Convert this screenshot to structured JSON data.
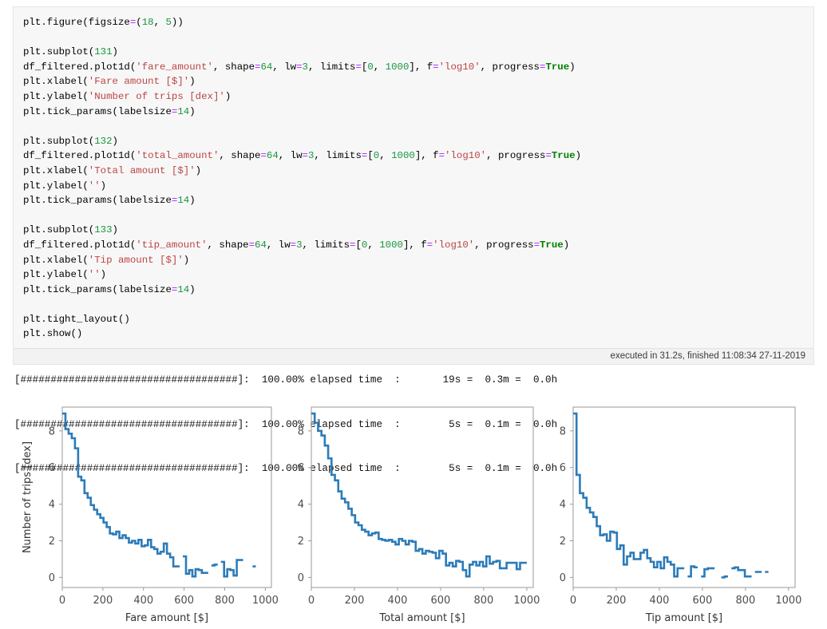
{
  "notebook": {
    "cell": {
      "language": "python",
      "code_lines": [
        [
          {
            "t": "plt.figure(figsize",
            "c": "fn"
          },
          {
            "t": "=",
            "c": "op"
          },
          {
            "t": "(",
            "c": "fn"
          },
          {
            "t": "18",
            "c": "num"
          },
          {
            "t": ", ",
            "c": "fn"
          },
          {
            "t": "5",
            "c": "num"
          },
          {
            "t": "))",
            "c": "fn"
          }
        ],
        [],
        [
          {
            "t": "plt.subplot(",
            "c": "fn"
          },
          {
            "t": "131",
            "c": "num"
          },
          {
            "t": ")",
            "c": "fn"
          }
        ],
        [
          {
            "t": "df_filtered.plot1d(",
            "c": "fn"
          },
          {
            "t": "'fare_amount'",
            "c": "str"
          },
          {
            "t": ", shape",
            "c": "fn"
          },
          {
            "t": "=",
            "c": "op"
          },
          {
            "t": "64",
            "c": "num"
          },
          {
            "t": ", lw",
            "c": "fn"
          },
          {
            "t": "=",
            "c": "op"
          },
          {
            "t": "3",
            "c": "num"
          },
          {
            "t": ", limits",
            "c": "fn"
          },
          {
            "t": "=",
            "c": "op"
          },
          {
            "t": "[",
            "c": "fn"
          },
          {
            "t": "0",
            "c": "num"
          },
          {
            "t": ", ",
            "c": "fn"
          },
          {
            "t": "1000",
            "c": "num"
          },
          {
            "t": "], f",
            "c": "fn"
          },
          {
            "t": "=",
            "c": "op"
          },
          {
            "t": "'log10'",
            "c": "str"
          },
          {
            "t": ", progress",
            "c": "fn"
          },
          {
            "t": "=",
            "c": "op"
          },
          {
            "t": "True",
            "c": "bool"
          },
          {
            "t": ")",
            "c": "fn"
          }
        ],
        [
          {
            "t": "plt.xlabel(",
            "c": "fn"
          },
          {
            "t": "'Fare amount [$]'",
            "c": "str"
          },
          {
            "t": ")",
            "c": "fn"
          }
        ],
        [
          {
            "t": "plt.ylabel(",
            "c": "fn"
          },
          {
            "t": "'Number of trips [dex]'",
            "c": "str"
          },
          {
            "t": ")",
            "c": "fn"
          }
        ],
        [
          {
            "t": "plt.tick_params(labelsize",
            "c": "fn"
          },
          {
            "t": "=",
            "c": "op"
          },
          {
            "t": "14",
            "c": "num"
          },
          {
            "t": ")",
            "c": "fn"
          }
        ],
        [],
        [
          {
            "t": "plt.subplot(",
            "c": "fn"
          },
          {
            "t": "132",
            "c": "num"
          },
          {
            "t": ")",
            "c": "fn"
          }
        ],
        [
          {
            "t": "df_filtered.plot1d(",
            "c": "fn"
          },
          {
            "t": "'total_amount'",
            "c": "str"
          },
          {
            "t": ", shape",
            "c": "fn"
          },
          {
            "t": "=",
            "c": "op"
          },
          {
            "t": "64",
            "c": "num"
          },
          {
            "t": ", lw",
            "c": "fn"
          },
          {
            "t": "=",
            "c": "op"
          },
          {
            "t": "3",
            "c": "num"
          },
          {
            "t": ", limits",
            "c": "fn"
          },
          {
            "t": "=",
            "c": "op"
          },
          {
            "t": "[",
            "c": "fn"
          },
          {
            "t": "0",
            "c": "num"
          },
          {
            "t": ", ",
            "c": "fn"
          },
          {
            "t": "1000",
            "c": "num"
          },
          {
            "t": "], f",
            "c": "fn"
          },
          {
            "t": "=",
            "c": "op"
          },
          {
            "t": "'log10'",
            "c": "str"
          },
          {
            "t": ", progress",
            "c": "fn"
          },
          {
            "t": "=",
            "c": "op"
          },
          {
            "t": "True",
            "c": "bool"
          },
          {
            "t": ")",
            "c": "fn"
          }
        ],
        [
          {
            "t": "plt.xlabel(",
            "c": "fn"
          },
          {
            "t": "'Total amount [$]'",
            "c": "str"
          },
          {
            "t": ")",
            "c": "fn"
          }
        ],
        [
          {
            "t": "plt.ylabel(",
            "c": "fn"
          },
          {
            "t": "''",
            "c": "str"
          },
          {
            "t": ")",
            "c": "fn"
          }
        ],
        [
          {
            "t": "plt.tick_params(labelsize",
            "c": "fn"
          },
          {
            "t": "=",
            "c": "op"
          },
          {
            "t": "14",
            "c": "num"
          },
          {
            "t": ")",
            "c": "fn"
          }
        ],
        [],
        [
          {
            "t": "plt.subplot(",
            "c": "fn"
          },
          {
            "t": "133",
            "c": "num"
          },
          {
            "t": ")",
            "c": "fn"
          }
        ],
        [
          {
            "t": "df_filtered.plot1d(",
            "c": "fn"
          },
          {
            "t": "'tip_amount'",
            "c": "str"
          },
          {
            "t": ", shape",
            "c": "fn"
          },
          {
            "t": "=",
            "c": "op"
          },
          {
            "t": "64",
            "c": "num"
          },
          {
            "t": ", lw",
            "c": "fn"
          },
          {
            "t": "=",
            "c": "op"
          },
          {
            "t": "3",
            "c": "num"
          },
          {
            "t": ", limits",
            "c": "fn"
          },
          {
            "t": "=",
            "c": "op"
          },
          {
            "t": "[",
            "c": "fn"
          },
          {
            "t": "0",
            "c": "num"
          },
          {
            "t": ", ",
            "c": "fn"
          },
          {
            "t": "1000",
            "c": "num"
          },
          {
            "t": "], f",
            "c": "fn"
          },
          {
            "t": "=",
            "c": "op"
          },
          {
            "t": "'log10'",
            "c": "str"
          },
          {
            "t": ", progress",
            "c": "fn"
          },
          {
            "t": "=",
            "c": "op"
          },
          {
            "t": "True",
            "c": "bool"
          },
          {
            "t": ")",
            "c": "fn"
          }
        ],
        [
          {
            "t": "plt.xlabel(",
            "c": "fn"
          },
          {
            "t": "'Tip amount [$]'",
            "c": "str"
          },
          {
            "t": ")",
            "c": "fn"
          }
        ],
        [
          {
            "t": "plt.ylabel(",
            "c": "fn"
          },
          {
            "t": "''",
            "c": "str"
          },
          {
            "t": ")",
            "c": "fn"
          }
        ],
        [
          {
            "t": "plt.tick_params(labelsize",
            "c": "fn"
          },
          {
            "t": "=",
            "c": "op"
          },
          {
            "t": "14",
            "c": "num"
          },
          {
            "t": ")",
            "c": "fn"
          }
        ],
        [],
        [
          {
            "t": "plt.tight_layout()",
            "c": "fn"
          }
        ],
        [
          {
            "t": "plt.show()",
            "c": "fn"
          }
        ]
      ],
      "execution_info": "executed in 31.2s, finished 11:08:34 27-11-2019"
    },
    "output": {
      "progress_lines": [
        "[####################################]:  100.00% elapsed time  :       19s =  0.3m =  0.0h",
        "[####################################]:  100.00% elapsed time  :        5s =  0.1m =  0.0h",
        "[####################################]:  100.00% elapsed time  :        5s =  0.1m =  0.0h"
      ]
    }
  },
  "theme": {
    "line_color": "#2b7bb9",
    "axis_color": "#9a9a9a",
    "tick_text_color": "#4d4d4d",
    "cell_background": "#f7f7f7",
    "exec_bar_background": "#f2f2f2"
  },
  "chart_data": [
    {
      "type": "line",
      "title": "",
      "xlabel": "Fare amount [$]",
      "ylabel": "Number of trips [dex]",
      "xlim": [
        0,
        1030
      ],
      "ylim": [
        -0.55,
        9.3
      ],
      "xticks": [
        0,
        200,
        400,
        600,
        800,
        1000
      ],
      "yticks": [
        0,
        2,
        4,
        6,
        8
      ],
      "grid": false,
      "legend": "none",
      "bin_edges_step": 15.625,
      "x": [
        0,
        15.6,
        31.3,
        46.9,
        62.5,
        78.1,
        93.8,
        109.4,
        125,
        140.6,
        156.3,
        171.9,
        187.5,
        203.1,
        218.8,
        234.4,
        250,
        265.6,
        281.3,
        296.9,
        312.5,
        328.1,
        343.8,
        359.4,
        375,
        390.6,
        406.3,
        421.9,
        437.5,
        453.1,
        468.8,
        484.4,
        500,
        515.6,
        531.3,
        546.9,
        562.5,
        578.1,
        593.8,
        609.4,
        625,
        640.6,
        656.3,
        671.9,
        687.5,
        703.1,
        718.8,
        734.4,
        750,
        765.6,
        781.3,
        796.9,
        812.5,
        828.1,
        843.8,
        859.4,
        875,
        890.6,
        906.3,
        921.9,
        937.5,
        953.1,
        968.8,
        984.4
      ],
      "values": [
        8.95,
        8.1,
        7.85,
        7.6,
        7.05,
        5.5,
        5.3,
        4.6,
        4.35,
        3.95,
        3.7,
        3.45,
        3.25,
        3.0,
        2.75,
        2.4,
        2.35,
        2.5,
        2.15,
        2.3,
        2.15,
        1.9,
        2.0,
        1.85,
        2.05,
        1.7,
        1.75,
        2.05,
        1.65,
        1.55,
        1.3,
        1.4,
        1.85,
        1.3,
        1.1,
        0.6,
        0.6,
        null,
        1.15,
        0.2,
        0.4,
        0.05,
        0.45,
        0.4,
        0.25,
        0.25,
        null,
        0.65,
        0.7,
        null,
        0.85,
        0.05,
        0.45,
        0.4,
        0.1,
        0.95,
        0.95,
        null,
        null,
        null,
        0.6,
        null,
        null,
        null
      ]
    },
    {
      "type": "line",
      "title": "",
      "xlabel": "Total amount [$]",
      "ylabel": "",
      "xlim": [
        0,
        1030
      ],
      "ylim": [
        -0.55,
        9.3
      ],
      "xticks": [
        0,
        200,
        400,
        600,
        800,
        1000
      ],
      "yticks": [
        0,
        2,
        4,
        6,
        8
      ],
      "grid": false,
      "legend": "none",
      "bin_edges_step": 15.625,
      "x": [
        0,
        15.6,
        31.3,
        46.9,
        62.5,
        78.1,
        93.8,
        109.4,
        125,
        140.6,
        156.3,
        171.9,
        187.5,
        203.1,
        218.8,
        234.4,
        250,
        265.6,
        281.3,
        296.9,
        312.5,
        328.1,
        343.8,
        359.4,
        375,
        390.6,
        406.3,
        421.9,
        437.5,
        453.1,
        468.8,
        484.4,
        500,
        515.6,
        531.3,
        546.9,
        562.5,
        578.1,
        593.8,
        609.4,
        625,
        640.6,
        656.3,
        671.9,
        687.5,
        703.1,
        718.8,
        734.4,
        750,
        765.6,
        781.3,
        796.9,
        812.5,
        828.1,
        843.8,
        859.4,
        875,
        890.6,
        906.3,
        921.9,
        937.5,
        953.1,
        968.8,
        984.4
      ],
      "values": [
        8.95,
        8.45,
        8.0,
        7.75,
        7.2,
        6.5,
        5.6,
        5.3,
        4.7,
        4.3,
        4.1,
        3.75,
        3.4,
        3.0,
        2.85,
        2.6,
        2.5,
        2.3,
        2.4,
        2.45,
        2.1,
        2.05,
        2.0,
        2.05,
        1.95,
        1.8,
        2.1,
        2.0,
        1.8,
        2.0,
        1.95,
        1.45,
        1.55,
        1.3,
        1.45,
        1.4,
        1.35,
        1.05,
        1.45,
        1.3,
        0.65,
        0.8,
        0.6,
        0.9,
        0.85,
        0.4,
        0.05,
        0.7,
        0.85,
        0.65,
        0.85,
        0.6,
        1.15,
        0.75,
        0.85,
        0.9,
        0.5,
        0.5,
        0.8,
        0.8,
        0.8,
        0.45,
        0.8,
        0.8
      ]
    },
    {
      "type": "line",
      "title": "",
      "xlabel": "Tip amount [$]",
      "ylabel": "",
      "xlim": [
        0,
        1030
      ],
      "ylim": [
        -0.55,
        9.3
      ],
      "xticks": [
        0,
        200,
        400,
        600,
        800,
        1000
      ],
      "yticks": [
        0,
        2,
        4,
        6,
        8
      ],
      "grid": false,
      "legend": "none",
      "bin_edges_step": 15.625,
      "x": [
        0,
        15.6,
        31.3,
        46.9,
        62.5,
        78.1,
        93.8,
        109.4,
        125,
        140.6,
        156.3,
        171.9,
        187.5,
        203.1,
        218.8,
        234.4,
        250,
        265.6,
        281.3,
        296.9,
        312.5,
        328.1,
        343.8,
        359.4,
        375,
        390.6,
        406.3,
        421.9,
        437.5,
        453.1,
        468.8,
        484.4,
        500,
        515.6,
        531.3,
        546.9,
        562.5,
        578.1,
        593.8,
        609.4,
        625,
        640.6,
        656.3,
        671.9,
        687.5,
        703.1,
        718.8,
        734.4,
        750,
        765.6,
        781.3,
        796.9,
        812.5,
        828.1,
        843.8,
        859.4,
        875,
        890.6,
        906.3,
        921.9,
        937.5,
        953.1,
        968.8,
        984.4
      ],
      "values": [
        8.95,
        5.6,
        4.6,
        4.35,
        3.8,
        3.55,
        3.3,
        2.8,
        2.3,
        2.35,
        2.0,
        2.5,
        2.45,
        1.55,
        1.75,
        0.7,
        1.15,
        1.35,
        1.0,
        1.0,
        1.35,
        1.5,
        1.05,
        0.85,
        0.55,
        0.85,
        0.5,
        1.1,
        0.85,
        0.7,
        0.05,
        0.5,
        0.5,
        null,
        0.05,
        0.6,
        0.55,
        null,
        0.05,
        0.45,
        0.5,
        0.5,
        null,
        null,
        0.0,
        0.05,
        null,
        0.5,
        0.55,
        0.4,
        0.4,
        0.05,
        0.05,
        null,
        0.3,
        0.3,
        null,
        0.3,
        null,
        null,
        null,
        null,
        null,
        null
      ]
    }
  ]
}
